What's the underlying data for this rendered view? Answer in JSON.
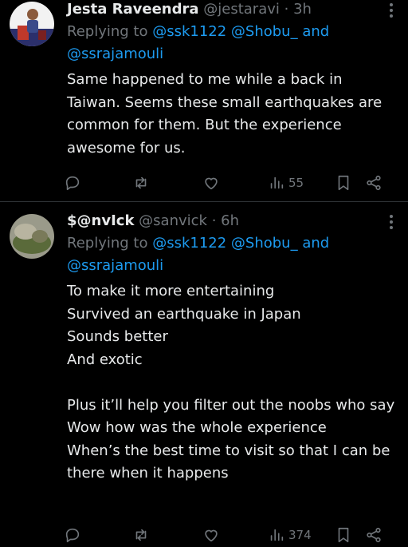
{
  "tweets": [
    {
      "name": "Jesta Raveendra",
      "handle": "@jestaravi",
      "dot": "·",
      "time": "3h",
      "reply_prefix": "Replying to ",
      "reply_mentions": "@ssk1122 @Shobu_",
      "reply_and": " and",
      "reply_mention_2": "@ssrajamouli",
      "body": "Same happened to me while a back in Taiwan. Seems these small earthquakes are common for them. But the experience awesome for us.",
      "views": "55"
    },
    {
      "name": "$@nvIck",
      "handle": "@sanvick",
      "dot": "·",
      "time": "6h",
      "reply_prefix": "Replying to ",
      "reply_mentions": "@ssk1122 @Shobu_",
      "reply_and": " and",
      "reply_mention_2": "@ssrajamouli",
      "body": "To make it more entertaining\nSurvived an earthquake in Japan\nSounds better\nAnd exotic\n\nPlus it’ll help you filter out the noobs who say\nWow how was the whole experience\nWhen’s the best time to visit so that I can be there when it happens",
      "views": "374"
    }
  ],
  "colors": {
    "accent": "#1d9bf0",
    "muted": "#71767b",
    "text": "#e7e9ea",
    "bg": "#000000"
  },
  "icons": [
    "reply-icon",
    "retweet-icon",
    "like-icon",
    "views-icon",
    "bookmark-icon",
    "share-icon",
    "more-icon"
  ]
}
